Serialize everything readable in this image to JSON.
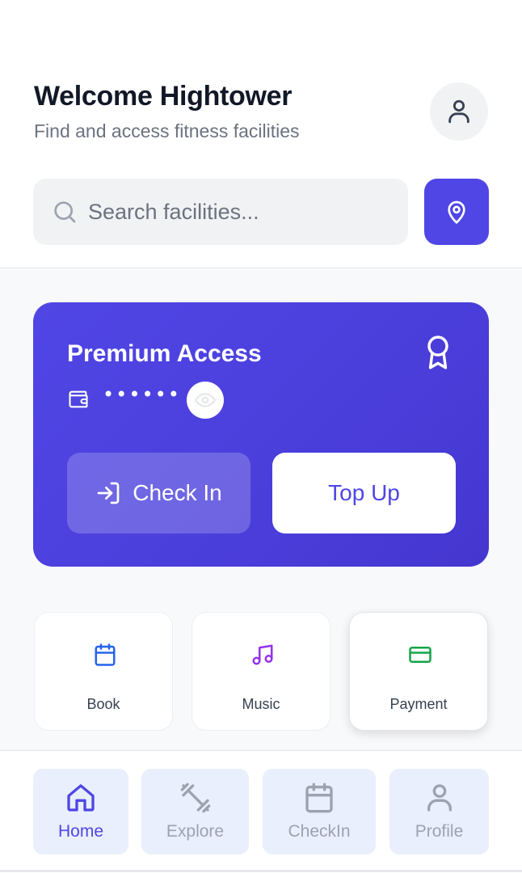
{
  "header": {
    "welcome": "Welcome Hightower",
    "subtitle": "Find and access fitness facilities"
  },
  "search": {
    "placeholder": "Search facilities...",
    "value": ""
  },
  "card": {
    "title": "Premium Access",
    "balance_mask": "••••••",
    "checkin_label": "Check In",
    "topup_label": "Top Up"
  },
  "quick_actions": [
    {
      "label": "Book",
      "icon": "calendar-icon",
      "color": "#2563eb"
    },
    {
      "label": "Music",
      "icon": "music-icon",
      "color": "#9333ea"
    },
    {
      "label": "Payment",
      "icon": "credit-card-icon",
      "color": "#16a34a"
    }
  ],
  "nav": [
    {
      "label": "Home",
      "icon": "home-icon",
      "active": true
    },
    {
      "label": "Explore",
      "icon": "dumbbell-icon",
      "active": false
    },
    {
      "label": "CheckIn",
      "icon": "calendar-icon",
      "active": false
    },
    {
      "label": "Profile",
      "icon": "user-icon",
      "active": false
    }
  ],
  "colors": {
    "accent": "#4f46e5",
    "text_primary": "#111827",
    "text_secondary": "#6b7280",
    "nav_inactive": "#9ca3af",
    "nav_bg": "#e9effc"
  }
}
